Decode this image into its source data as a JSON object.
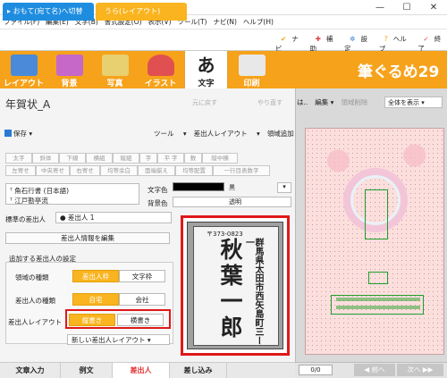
{
  "window": {
    "title": "筆ぐるめ for Windows",
    "min": "—",
    "max": "☐",
    "close": "✕"
  },
  "menu": [
    "ファイル(F)",
    "編集(E)",
    "文字(B)",
    "書式設定(O)",
    "表示(V)",
    "ツール(T)",
    "ナビ(N)",
    "ヘルプ(H)"
  ],
  "tabs": {
    "omote": "おもて(宛て名)へ切替",
    "ura": "うら(レイアウト)"
  },
  "help_links": [
    "ナビ",
    "補助",
    "設定",
    "ヘルプ",
    "終了"
  ],
  "ribbon": {
    "items": [
      "レイアウト",
      "背景",
      "写真",
      "イラスト",
      "文字",
      "印刷"
    ],
    "selected": "文字",
    "brand": "筆ぐるめ29"
  },
  "left": {
    "doc_title": "年賀状_A",
    "undo": "元に戻す",
    "redo": "やり直す",
    "save": "保存",
    "tools": [
      "ツール",
      "差出人レイアウト",
      "領域追加"
    ],
    "format_buttons_row1": [
      "太字",
      "斜体",
      "下線",
      "横組",
      "縦組",
      "字",
      "平 字",
      "数",
      "縦中横"
    ],
    "format_buttons_row2": [
      "左寄せ",
      "中央寄せ",
      "右寄せ",
      "均等余白",
      "面端揃え",
      "均等配置",
      "一行目表数字"
    ],
    "fonts": [
      "魚石行書 (日本語)",
      "江戸勘亭流"
    ],
    "color_label": "文字色",
    "color_name": "黒",
    "bg_label": "背景色",
    "bg_value": "透明",
    "standard_sender_label": "標準の差出人",
    "standard_sender_value": "● 差出人 1",
    "edit_sender_info": "差出人情報を編集",
    "sender_settings_header": "追加する差出人の設定",
    "area_type_label": "領域の種類",
    "area_type_options": [
      "差出人枠",
      "文字枠"
    ],
    "sender_type_label": "差出人の種類",
    "sender_type_options": [
      "自宅",
      "会社"
    ],
    "layout_label": "差出人レイアウト",
    "layout_options": [
      "縦書き",
      "横書き"
    ],
    "new_layout": "新しい差出人レイアウト",
    "preview": {
      "zip": "〒373-0823",
      "address": "群馬県太田市西矢島町三ー一",
      "name": "秋葉一郎"
    }
  },
  "bottom_tabs": [
    "文章入力",
    "例文",
    "差出人",
    "差し込み"
  ],
  "bottom_selected": "差出人",
  "right": {
    "toolbar": [
      "は..",
      "編集 ▾",
      "領域削除"
    ],
    "display_mode": "全体を表示",
    "page": "0/0",
    "prev": "前へ",
    "next": "次へ"
  },
  "colors": {
    "accent_orange": "#f6a21b",
    "tab_blue": "#1e8de0",
    "highlight_red": "#e01818",
    "guide_green": "#1fa02a"
  }
}
